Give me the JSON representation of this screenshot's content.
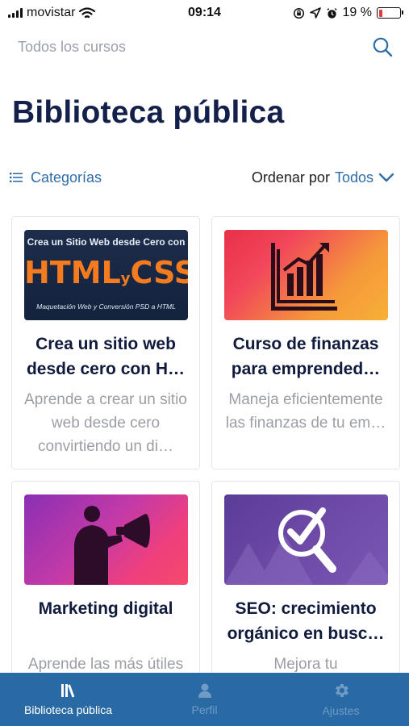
{
  "status_bar": {
    "carrier": "movistar",
    "time": "09:14",
    "battery_percent": "19 %",
    "battery_level": 0.19,
    "battery_color": "#e53935"
  },
  "search": {
    "placeholder": "Todos los cursos",
    "icon": "search-icon"
  },
  "page_title": "Biblioteca pública",
  "filters": {
    "categories_label": "Categorías",
    "categories_icon": "list-icon",
    "sort_label": "Ordenar por",
    "sort_value": "Todos",
    "sort_icon": "chevron-down-icon"
  },
  "courses": [
    {
      "title": "Crea un sitio web desde cero con H…",
      "description": "Aprende a crear un sitio web desde cero convirtiendo un di…",
      "thumbnail": {
        "top_text": "Crea un Sitio Web desde Cero con",
        "main_text_a": "HTML",
        "main_text_y": "y",
        "main_text_b": "CSS",
        "bottom_text": "Maquetación Web y Conversión PSD a HTML"
      }
    },
    {
      "title": "Curso de finanzas para emprended…",
      "description": "Maneja eficientemente las finanzas de tu em…",
      "thumbnail": {
        "icon": "bar-chart-growth-icon"
      }
    },
    {
      "title": "Marketing digital",
      "description": "Aprende las más útiles herramientas",
      "thumbnail": {
        "icon": "megaphone-person-icon"
      }
    },
    {
      "title": "SEO: crecimiento orgánico en busc…",
      "description": "Mejora tu",
      "thumbnail": {
        "icon": "magnifier-check-icon"
      }
    }
  ],
  "tab_bar": {
    "background": "#2a6aa4",
    "tabs": [
      {
        "label": "Biblioteca pública",
        "icon": "library-icon",
        "active": true
      },
      {
        "label": "Perfil",
        "icon": "person-icon",
        "active": false
      },
      {
        "label": "Ajustes",
        "icon": "gear-icon",
        "active": false
      }
    ]
  }
}
